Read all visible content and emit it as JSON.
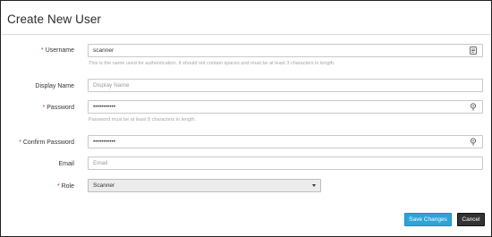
{
  "dialog": {
    "title": "Create New User"
  },
  "form": {
    "username": {
      "label": "Username",
      "required_mark": "*",
      "value": "scanner",
      "help": "This is the name used for authentication. It should not contain spaces and must be at least 3 characters in length.",
      "icon": "contact-card-icon"
    },
    "display_name": {
      "label": "Display Name",
      "placeholder": "Display Name"
    },
    "password": {
      "label": "Password",
      "required_mark": "*",
      "value": "•••••••••••",
      "help": "Password must be at least 8 characters in length.",
      "icon": "key-icon"
    },
    "confirm_password": {
      "label": "Confirm Password",
      "required_mark": "*",
      "value": "•••••••••••",
      "icon": "key-icon"
    },
    "email": {
      "label": "Email",
      "placeholder": "Email"
    },
    "role": {
      "label": "Role",
      "required_mark": "*",
      "value": "Scanner"
    }
  },
  "actions": {
    "save_label": "Save Changes",
    "cancel_label": "Cancel"
  },
  "colors": {
    "save_button": "#2fa4d6",
    "cancel_button": "#333333",
    "required_mark": "#c0392b"
  }
}
